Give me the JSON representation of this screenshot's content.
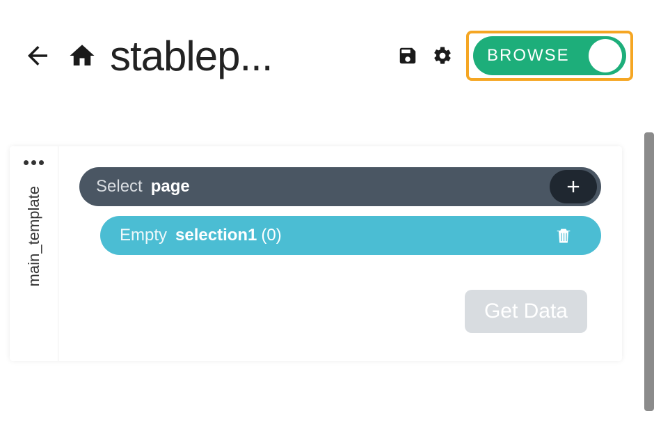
{
  "header": {
    "title": "stablep...",
    "toggle_label": "BROWSE"
  },
  "sidebar": {
    "tab_label": "main_template"
  },
  "select_row": {
    "prefix": "Select",
    "target": "page"
  },
  "selection_row": {
    "prefix": "Empty",
    "name": "selection1",
    "count": "(0)"
  },
  "actions": {
    "get_data": "Get Data"
  }
}
